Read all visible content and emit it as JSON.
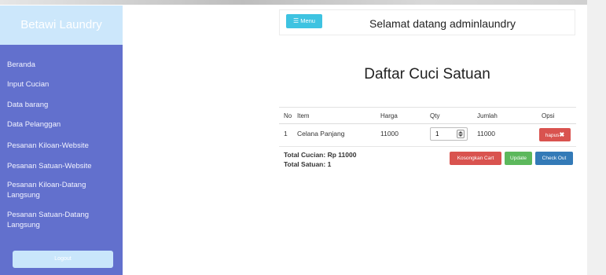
{
  "brand": "Betawi Laundry",
  "sidebar": {
    "items": [
      {
        "label": "Beranda"
      },
      {
        "label": "Input Cucian"
      },
      {
        "label": "Data barang"
      },
      {
        "label": "Data Pelanggan"
      },
      {
        "label": "Pesanan Kiloan-Website"
      },
      {
        "label": "Pesanan Satuan-Website"
      },
      {
        "label": "Pesanan Kiloan-Datang Langsung"
      },
      {
        "label": "Pesanan Satuan-Datang Langsung"
      }
    ],
    "logout_label": "Logout"
  },
  "header": {
    "menu_label": "Menu",
    "menu_icon": "list-icon",
    "welcome": "Selamat datang adminlaundry"
  },
  "main": {
    "title": "Daftar Cuci Satuan",
    "columns": [
      "No",
      "Item",
      "Harga",
      "Qty",
      "Jumlah",
      "Opsi"
    ],
    "rows": [
      {
        "no": "1",
        "item": "Celana Panjang",
        "harga": "11000",
        "qty": "1",
        "jumlah": "11000",
        "delete_label": "hapus"
      }
    ],
    "total_cucian": "Total Cucian: Rp 11000",
    "total_satuan": "Total Satuan: 1",
    "buttons": {
      "empty_cart": "Kosongkan Cart",
      "update": "Update",
      "checkout": "Check Out"
    }
  },
  "colors": {
    "sidebar": "#6270cd",
    "brand_bg": "#cce7fb",
    "menu_button": "#3ec3e1",
    "danger": "#d9534f",
    "success": "#5cb85c",
    "primary": "#337ab7"
  }
}
